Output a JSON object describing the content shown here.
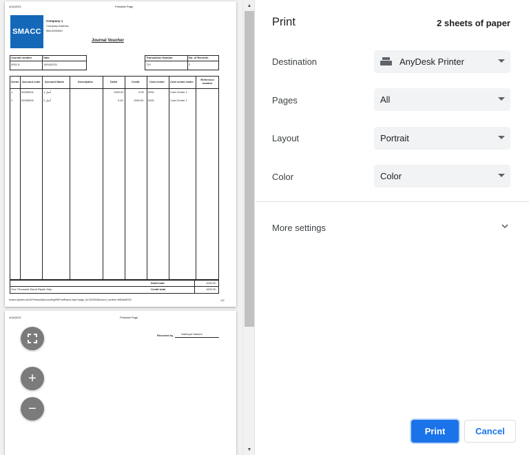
{
  "preview": {
    "page1": {
      "header_date": "4/16/2021",
      "header_title": "Printable Page",
      "logo_text": "SMACC",
      "company_name": "Company 1",
      "company_address": "Company Address",
      "company_phone": "966-0000000",
      "doc_title": "Journal Voucher",
      "info_labels": {
        "journal_number": "Journal number",
        "date": "Date",
        "transaction_number": "Transaction Number",
        "no_of_records": "No. of Records"
      },
      "info_values": {
        "journal_number": "0001-6",
        "date": "15/04/2021",
        "transaction_number": "724",
        "no_of_records": "2"
      },
      "columns": [
        "Serial",
        "Account code",
        "Account Name",
        "Description",
        "Debit",
        "Credit",
        "Cost center",
        "Cost center name",
        "Reference number"
      ],
      "rows": [
        [
          "1",
          "00330001",
          "أصل 1",
          "",
          "1000.00",
          "0.00",
          "0001",
          "Cost Center 1",
          ""
        ],
        [
          "2",
          "00330002",
          "أصل 2",
          "",
          "0.00",
          "1000.00",
          "0001",
          "Cost Center 1",
          ""
        ]
      ],
      "amount_words": "One Thousand Saudi Riyals Only",
      "debit_total_label": "Debit total",
      "debit_total_value": "1000.00",
      "credit_total_label": "Credit total",
      "credit_total_value": "1000.00",
      "footer_url": "smacc.dyndns.biz:81/FinancialAccounting/PAPrintReport.aspx?page_id=2020/03&record_number=MDAwMS03",
      "footer_page": "1/2"
    },
    "page2": {
      "header_date": "4/16/2021",
      "header_title": "Printable Page",
      "received_by_label": "Received by",
      "received_by_value": "Sabeeya Hashmi"
    },
    "zoom": {
      "fit_icon": "fit-to-page-icon",
      "zoom_in": "+",
      "zoom_out": "−"
    }
  },
  "settings": {
    "title": "Print",
    "sheet_count": "2 sheets of paper",
    "destination_label": "Destination",
    "destination_value": "AnyDesk Printer",
    "pages_label": "Pages",
    "pages_value": "All",
    "layout_label": "Layout",
    "layout_value": "Portrait",
    "color_label": "Color",
    "color_value": "Color",
    "more_settings_label": "More settings",
    "print_label": "Print",
    "cancel_label": "Cancel"
  },
  "colors": {
    "accent": "#1a73e8",
    "logo_blue": "#1568b8",
    "select_bg": "#f1f3f4"
  }
}
